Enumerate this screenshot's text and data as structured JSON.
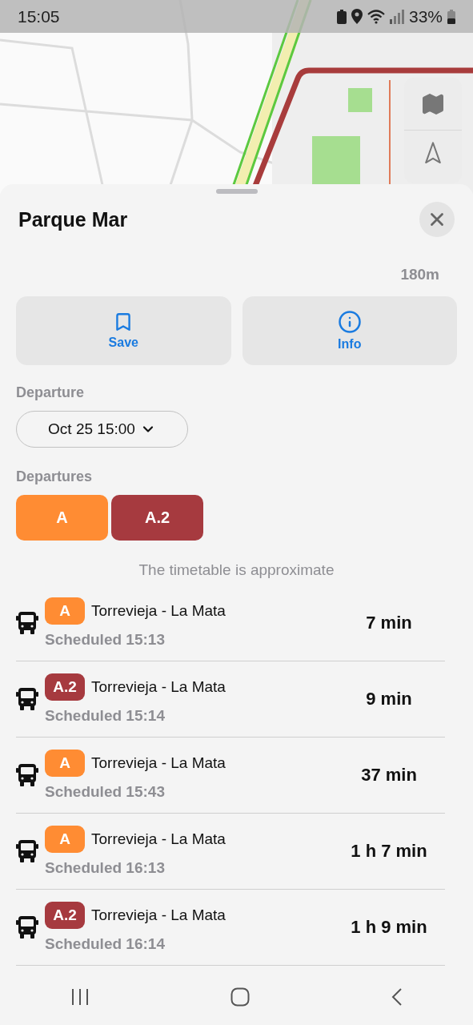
{
  "status_bar": {
    "time": "15:05",
    "battery": "33%"
  },
  "stop": {
    "name": "Parque Mar",
    "distance": "180m"
  },
  "actions": [
    {
      "kind": "save",
      "label": "Save"
    },
    {
      "kind": "info",
      "label": "Info"
    }
  ],
  "departure": {
    "label": "Departure",
    "value": "Oct 25 15:00"
  },
  "departures": {
    "label": "Departures",
    "routes": [
      {
        "name": "A",
        "color": "#ff8c33"
      },
      {
        "name": "A.2",
        "color": "#a63a3f"
      }
    ]
  },
  "note": "The timetable is approximate",
  "rows": [
    {
      "route": "A",
      "color": "#ff8c33",
      "destination": "Torrevieja - La Mata",
      "scheduled": "Scheduled 15:13",
      "eta": "7 min"
    },
    {
      "route": "A.2",
      "color": "#a63a3f",
      "destination": "Torrevieja - La Mata",
      "scheduled": "Scheduled 15:14",
      "eta": "9 min"
    },
    {
      "route": "A",
      "color": "#ff8c33",
      "destination": "Torrevieja - La Mata",
      "scheduled": "Scheduled 15:43",
      "eta": "37 min"
    },
    {
      "route": "A",
      "color": "#ff8c33",
      "destination": "Torrevieja - La Mata",
      "scheduled": "Scheduled 16:13",
      "eta": "1 h 7 min"
    },
    {
      "route": "A.2",
      "color": "#a63a3f",
      "destination": "Torrevieja - La Mata",
      "scheduled": "Scheduled 16:14",
      "eta": "1 h 9 min"
    }
  ]
}
